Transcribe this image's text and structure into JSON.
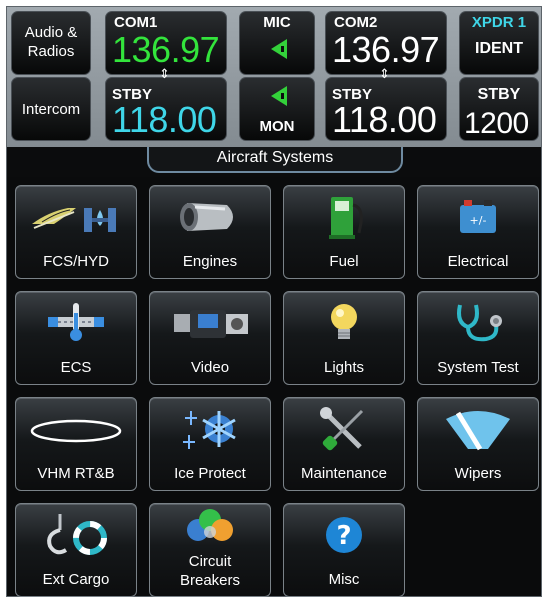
{
  "top": {
    "audio_label_1": "Audio &",
    "audio_label_2": "Radios",
    "intercom_label": "Intercom",
    "com1": {
      "label": "COM1",
      "active": "136.97",
      "stby_label": "STBY",
      "standby": "118.00",
      "active_color": "#33e43c",
      "standby_color": "#3fd6e8"
    },
    "mic": {
      "label": "MIC",
      "mon_label": "MON",
      "indicator_color": "#33d13a"
    },
    "com2": {
      "label": "COM2",
      "active": "136.97",
      "stby_label": "STBY",
      "standby": "118.00"
    },
    "xpdr": {
      "label": "XPDR 1",
      "ident_label": "IDENT",
      "stby_label": "STBY",
      "code": "1200",
      "label_color": "#3fd6e8"
    }
  },
  "section_title": "Aircraft Systems",
  "tiles": [
    {
      "label": "FCS/HYD",
      "icon": "fcs-hyd-icon"
    },
    {
      "label": "Engines",
      "icon": "engine-icon"
    },
    {
      "label": "Fuel",
      "icon": "fuel-pump-icon"
    },
    {
      "label": "Electrical",
      "icon": "battery-icon"
    },
    {
      "label": "ECS",
      "icon": "thermometer-icon"
    },
    {
      "label": "Video",
      "icon": "video-camera-icon"
    },
    {
      "label": "Lights",
      "icon": "light-bulb-icon"
    },
    {
      "label": "System Test",
      "icon": "stethoscope-icon"
    },
    {
      "label": "VHM RT&B",
      "icon": "rotor-track-ellipse-icon"
    },
    {
      "label": "Ice Protect",
      "icon": "snowflake-gear-icon"
    },
    {
      "label": "Maintenance",
      "icon": "wrench-screwdriver-icon"
    },
    {
      "label": "Wipers",
      "icon": "wiper-icon"
    },
    {
      "label": "Ext Cargo",
      "icon": "cargo-hook-icon"
    },
    {
      "label_1": "Circuit",
      "label_2": "Breakers",
      "icon": "circuit-breakers-icon"
    },
    {
      "label": "Misc",
      "icon": "question-icon"
    }
  ]
}
